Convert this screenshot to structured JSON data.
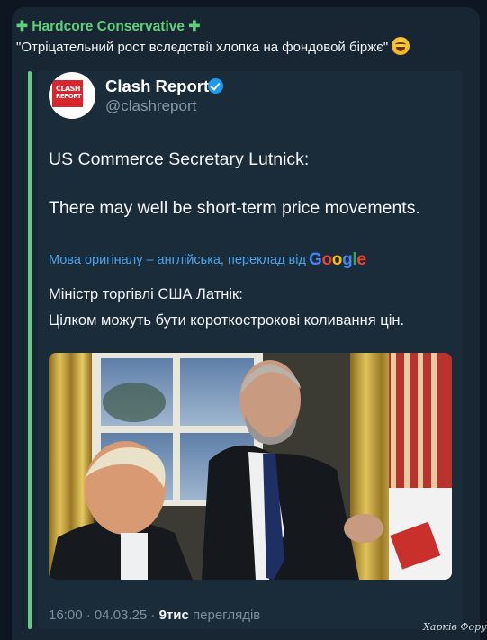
{
  "message": {
    "sender": "✚ Hardcore Conservative ✚",
    "caption": "\"Отріцательний рост вслєдствії хлопка на фондовой біржє\"",
    "caption_emoji": "laughing-crying-emoji"
  },
  "forward": {
    "avatar_text_line1": "CLASH",
    "avatar_text_line2": "REPORT",
    "channel_name": "Clash Report",
    "handle": "@clashreport",
    "tweet_line1": "US Commerce Secretary Lutnick:",
    "tweet_line2": "There may well be short-term price movements.",
    "translation_note": "Мова оригіналу – англійська, переклад від",
    "google_letters": [
      "G",
      "o",
      "o",
      "g",
      "l",
      "e"
    ],
    "translated_line1": "Міністр торгівлі США Латнік:",
    "translated_line2": "Цілком можуть бути короткострокові коливання цін."
  },
  "footer": {
    "time_date": "16:00 · 04.03.25 ·",
    "views_count": "9тис",
    "views_label": "переглядів"
  },
  "watermark": "Харків Форум",
  "colors": {
    "background": "#0e1621",
    "bubble": "#182533",
    "accent_green": "#5fcf7a",
    "link_blue": "#4aa3ea",
    "verified_blue": "#1d9bf0",
    "muted": "#7e8d9c"
  }
}
